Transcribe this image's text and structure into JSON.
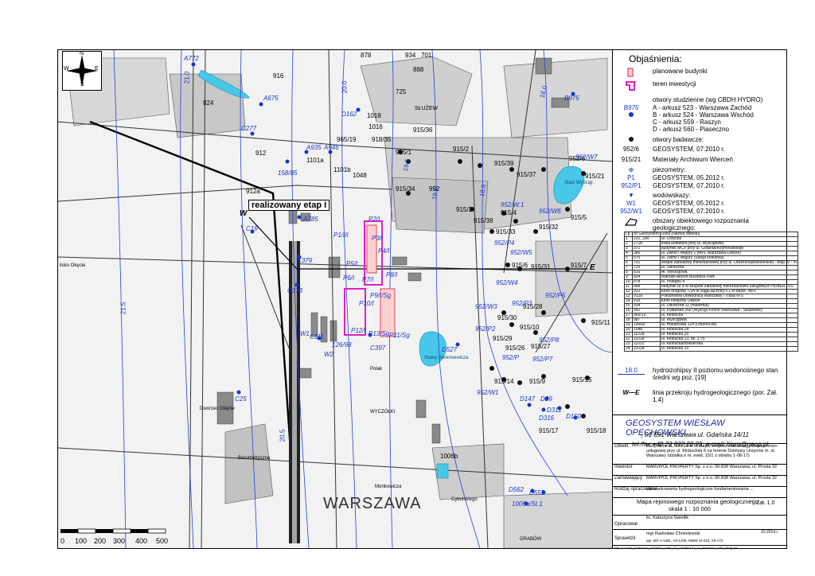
{
  "legend": {
    "title": "Objaśnienia:",
    "planned_buildings": "planowane budynki",
    "investment_area": "teren inwestycji",
    "wells_header": "otwory studzienne (wg CBDH HYDRO)",
    "well_symbol": "B975",
    "well_a": "A - arkusz 523 - Warszawa Zachód",
    "well_b": "B - arkusz 524 - Warszawa Wschód",
    "well_c": "C - arkusz 559 - Raszyn",
    "well_d": "D - arkusz 560 - Piaseczno",
    "research_wells": "otwory badawcze:",
    "geosystem_sym": "952/6",
    "geosystem_2010": "GEOSYSTEM, 07.2010 r.",
    "archive_sym": "915/21",
    "archive_txt": "Materiały Archiwum Wierceń",
    "piezometers": "piezometry:",
    "piezo_sym1": "P1",
    "piezo_sym2": "952/P1",
    "piezo_2012": "GEOSYSTEM, 05.2012 r.",
    "piezo_2010": "GEOSYSTEM, 07.2010 r.",
    "gauges": "wodowskazy:",
    "gauge_sym1": "W1",
    "gauge_sym2": "952/W1",
    "gauge_2012": "GEOSYSTEM, 05.2012 r.",
    "gauge_2010": "GEOSYSTEM, 07.2010 r.",
    "object_areas": "obszary obiektowego rozpoznania geologicznego:",
    "isohypse_sym": "18.0",
    "isohypse_txt": "hydroizohipsy II poziomu wodonośnego stan średni wg poz. [19]",
    "section_sym_w": "W",
    "section_sym_e": "E",
    "section_txt": "linia przekroju hydrogeologicznego (por. Zał. 1.4)"
  },
  "table": {
    "headers": [
      "Lp.",
      "Nr Geosystem",
      "Ulica (Nazwa obiektu)"
    ],
    "rows": [
      [
        "1",
        "221, 290",
        "ul. Orzycka"
      ],
      [
        "2",
        "271b",
        "trasa kolektora przy ul. Wyścigowej"
      ],
      [
        "3",
        "372",
        "budynek MCX przy ul. Gotarda/Rzymowskiego"
      ],
      [
        "4",
        "380",
        "ul. Żwirki i Wigury 1 (MPL Warszawa-Okęcie)"
      ],
      [
        "5",
        "575",
        "ul. Żwirki i Wigury (Stacja kolejowa)"
      ],
      [
        "6",
        "701",
        "zespół zabudowy mieszkaniowej przy ul. Obrzeżnej/Bokserskiej - etap IV - VI"
      ],
      [
        "7",
        "725",
        "ul. Obrzeżna"
      ],
      [
        "8",
        "816",
        "Al. Wyścigowa"
      ],
      [
        "9",
        "824",
        "Warsaw Airport Business Park"
      ],
      [
        "10",
        "878",
        "ul. Postępu 4"
      ],
      [
        "11",
        "888",
        "budynek nr 4 w zespole zabudowy mieszkaniowo-usługowych HUBERTUS"
      ],
      [
        "12",
        "912",
        "tunel drogowy T/34 w ciągu łącznicy Ł1 w węźle \"MPL\""
      ],
      [
        "13",
        "912a",
        "Południowa Obwodnica Warszawy i Trasa N-S"
      ],
      [
        "14",
        "916",
        "tunel kolejowy Okęcie"
      ],
      [
        "15",
        "934",
        "ul. Obrzeżna 11 (Hubertus)"
      ],
      [
        "16",
        "952",
        "ul. Puławska 266 (Wyścigi Konne Warszawa - Służewiec)"
      ],
      [
        "17",
        "965/19",
        "ul. Kłobucka"
      ],
      [
        "18",
        "987",
        "ul. Wyścigowa"
      ],
      [
        "19",
        "1006a",
        "ul. Hołubcowa 124 (UNIPROM)"
      ],
      [
        "20",
        "1048",
        "ul. Kłobucka 14"
      ],
      [
        "21",
        "1101a",
        "ul. Kłobucka 25"
      ],
      [
        "22",
        "1101b",
        "ul. Kłobucka 23, dz. 17/5"
      ],
      [
        "23",
        "1101c",
        "ul. Kłobucka/Bokserska"
      ],
      [
        "24",
        "1101d",
        "ul. Kłobucka 25"
      ]
    ]
  },
  "company": {
    "name": "GEOSYSTEM WIESŁAW OPĘCHOWSKI",
    "address": "01-691 Warszawa ul. Gdańska 14/11",
    "contact": "tel./fax +48 22 832 28 39, e-mail: biuro@geop.pl"
  },
  "meta": {
    "object_label": "Obiekt",
    "object_value": "Budynki nr 11, 12 i 13 w III etapie zespołu zabudowy mieszkaniowo-usługowej przy ul. Kłobuckiej 6 na terenie Dzielnicy Ursynów m. st. Warszawy (działka o nr. ewid. 15/1 z obrębu 1-08-17)",
    "investor_label": "Inwestor",
    "investor_value": "MARVIPOL PROPERTY Sp. z o.o. 00-838 Warszawa, ul. Prosta 32",
    "orderer_label": "Zamawiający",
    "orderer_value": "MARVIPOL PROPERTY Sp. z o.o. 00-838 Warszawa, ul. Prosta 32",
    "study_label": "Rodzaj opracowania",
    "study_value": "Uwarunkowania hydrogeologiczne fundamentowania ...",
    "map_title": "Mapa rejonowego rozpoznania geologicznego",
    "scale": "skala 1 : 10 000",
    "annex": "Zał. 1.0",
    "prepared_label": "Opracował",
    "prepared_value": "lic. Katarzyna Świetlik",
    "checked_label": "Sprawdził",
    "checked_value": "mgr Radosław Chmielewski",
    "checked_sub": "upr. MŚ V-1491, VII-1408, MMW XI-019, XII-172",
    "date": "10.2014 r.",
    "file": "Plik: X:11101_Kłobucka_UGGP\\11_UHF_\\11_13\\eP\\1101_11_Kłobucka_UHF_mmg.wrf"
  },
  "map": {
    "stage_callout": "realizowany etap I",
    "city": "WARSZAWA",
    "compass_n": "N",
    "compass_s": "S",
    "compass_e": "E",
    "compass_w": "W",
    "section_w": "W",
    "section_e": "E",
    "scale_labels": [
      "0",
      "100",
      "200",
      "300",
      "400",
      "500"
    ],
    "plot_labels": [
      "824",
      "912",
      "912a",
      "1048",
      "952",
      "725",
      "878",
      "934",
      "888",
      "701",
      "916",
      "1101a",
      "1101b",
      "1018",
      "1016",
      "965/19",
      "918/35",
      "915/36",
      "915/1",
      "915/2",
      "915/39",
      "915/37",
      "915/21",
      "915/34",
      "915/3",
      "915/38",
      "915/4",
      "915/5",
      "915/33",
      "915/32",
      "915/6",
      "915/31",
      "915/7",
      "915/30",
      "915/29",
      "915/10",
      "915/11",
      "915/26",
      "915/27",
      "915/28",
      "915/14",
      "915/9",
      "915/15",
      "915/17",
      "915/18",
      "1006b",
      "952/6"
    ],
    "wells": [
      "A772",
      "A675",
      "C277",
      "A935",
      "A946",
      "158/85",
      "A785",
      "C19",
      "C379",
      "C373",
      "C111",
      "126/98",
      "C397",
      "C25",
      "D162",
      "B975",
      "D527",
      "D147",
      "D29",
      "D311",
      "D316",
      "D150",
      "D562",
      "D555",
      "1006a/St.1",
      "W1",
      "W2"
    ],
    "piezometers": [
      "P1/III",
      "P2/I",
      "P3/I",
      "P4/I",
      "P5/I",
      "P6/I",
      "P7/I",
      "P8/I",
      "P9/I/Sg",
      "P10/I",
      "P12/I",
      "P13/Sg",
      "P11/Sg",
      "952/P4",
      "952/W5",
      "952/W.1",
      "952/W6",
      "952/W4",
      "952/P5",
      "952/P3",
      "952/W3",
      "952/P2",
      "952/P8",
      "952/P",
      "952/P7",
      "952/W1",
      "952/W7"
    ],
    "isohypses": [
      "21.0",
      "20.5",
      "20.0",
      "19.5",
      "19.0",
      "18.5",
      "18.0",
      "21.5"
    ],
    "place_labels": [
      "Staw Wyścigi",
      "Stawy Berensewicza",
      "SŁUŻEW",
      "Polak",
      "WYCZÓŁKI",
      "Dworzec Okęcie",
      "Mortkowicza",
      "Cybulskiego",
      "GRABÓW",
      "Barometryczna",
      "lisko Okęcie"
    ]
  },
  "colors": {
    "isohypse": "#2a3fd6",
    "pond": "#48c8e8",
    "investment": "#e020c8",
    "building_fill": "#bdbdbd",
    "research_dot": "#111111"
  }
}
